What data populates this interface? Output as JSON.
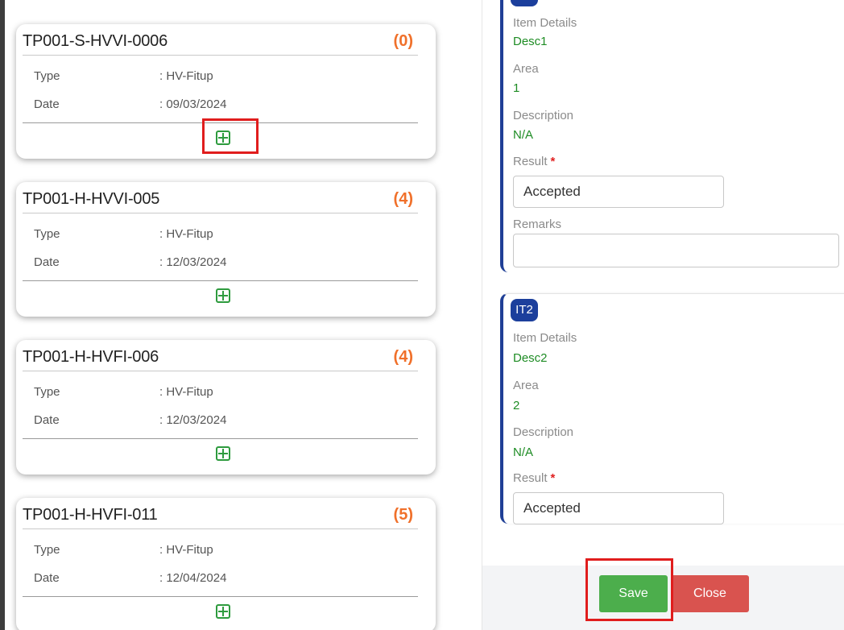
{
  "cards": [
    {
      "title": "TP001-S-HVVI-0006",
      "count": "(0)",
      "type_label": "Type",
      "type_value": ": HV-Fitup",
      "date_label": "Date",
      "date_value": ": 09/03/2024"
    },
    {
      "title": "TP001-H-HVVI-005",
      "count": "(4)",
      "type_label": "Type",
      "type_value": ": HV-Fitup",
      "date_label": "Date",
      "date_value": ": 12/03/2024"
    },
    {
      "title": "TP001-H-HVFI-006",
      "count": "(4)",
      "type_label": "Type",
      "type_value": ": HV-Fitup",
      "date_label": "Date",
      "date_value": ": 12/03/2024"
    },
    {
      "title": "TP001-H-HVFI-011",
      "count": "(5)",
      "type_label": "Type",
      "type_value": ": HV-Fitup",
      "date_label": "Date",
      "date_value": ": 12/04/2024"
    }
  ],
  "items": [
    {
      "tag": "",
      "item_details_label": "Item Details",
      "item_details_value": "Desc1",
      "area_label": "Area",
      "area_value": "1",
      "description_label": "Description",
      "description_value": "N/A",
      "result_label": "Result",
      "required_mark": "*",
      "result_value": "Accepted",
      "remarks_label": "Remarks",
      "remarks_value": ""
    },
    {
      "tag": "IT2",
      "item_details_label": "Item Details",
      "item_details_value": "Desc2",
      "area_label": "Area",
      "area_value": "2",
      "description_label": "Description",
      "description_value": "N/A",
      "result_label": "Result",
      "required_mark": "*",
      "result_value": "Accepted"
    }
  ],
  "footer": {
    "save_label": "Save",
    "close_label": "Close"
  },
  "colors": {
    "accent_blue": "#1c3f9c",
    "value_green": "#1e8c24",
    "count_orange": "#f0702a",
    "save_green": "#4cae4c",
    "close_red": "#d9534f",
    "highlight_red": "#e01d1d"
  }
}
